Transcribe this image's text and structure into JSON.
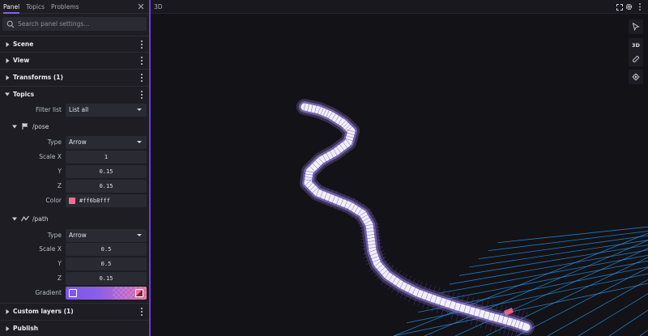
{
  "sidebar": {
    "tabs": [
      {
        "label": "Panel",
        "active": true
      },
      {
        "label": "Topics",
        "active": false
      },
      {
        "label": "Problems",
        "active": false
      }
    ],
    "search_placeholder": "Search panel settings...",
    "sections": {
      "scene": "Scene",
      "view": "View",
      "transforms": "Transforms (1)",
      "topics": "Topics",
      "custom_layers": "Custom layers (1)",
      "publish": "Publish"
    },
    "topics_panel": {
      "filter_label": "Filter list",
      "filter_value": "List all",
      "pose": {
        "name": "/pose",
        "type_label": "Type",
        "type_value": "Arrow",
        "scale_x_label": "Scale X",
        "scale_x": "1",
        "y_label": "Y",
        "y": "0.15",
        "z_label": "Z",
        "z": "0.15",
        "color_label": "Color",
        "color_value": "#ff6b8fff",
        "color_hex": "#ff6b8f"
      },
      "path": {
        "name": "/path",
        "type_label": "Type",
        "type_value": "Arrow",
        "scale_x_label": "Scale X",
        "scale_x": "0.5",
        "y_label": "Y",
        "y": "0.5",
        "z_label": "Z",
        "z": "0.15",
        "gradient_label": "Gradient",
        "gradient_start": "#7a56e9",
        "gradient_end": "#ff6b8f"
      }
    }
  },
  "viewport": {
    "title": "3D",
    "mode_label": "3D",
    "header_icons": [
      "fullscreen-icon",
      "gear-icon",
      "more-icon"
    ],
    "toolbar_icons": [
      "select-cursor-icon",
      "ruler-icon",
      "locate-icon"
    ],
    "grid_color": "#2fa7ff",
    "path_color": "#a88cf5"
  },
  "colors": {
    "accent": "#8a5cf5",
    "panel_bg": "#1d1d23",
    "viewport_bg": "#121217"
  }
}
